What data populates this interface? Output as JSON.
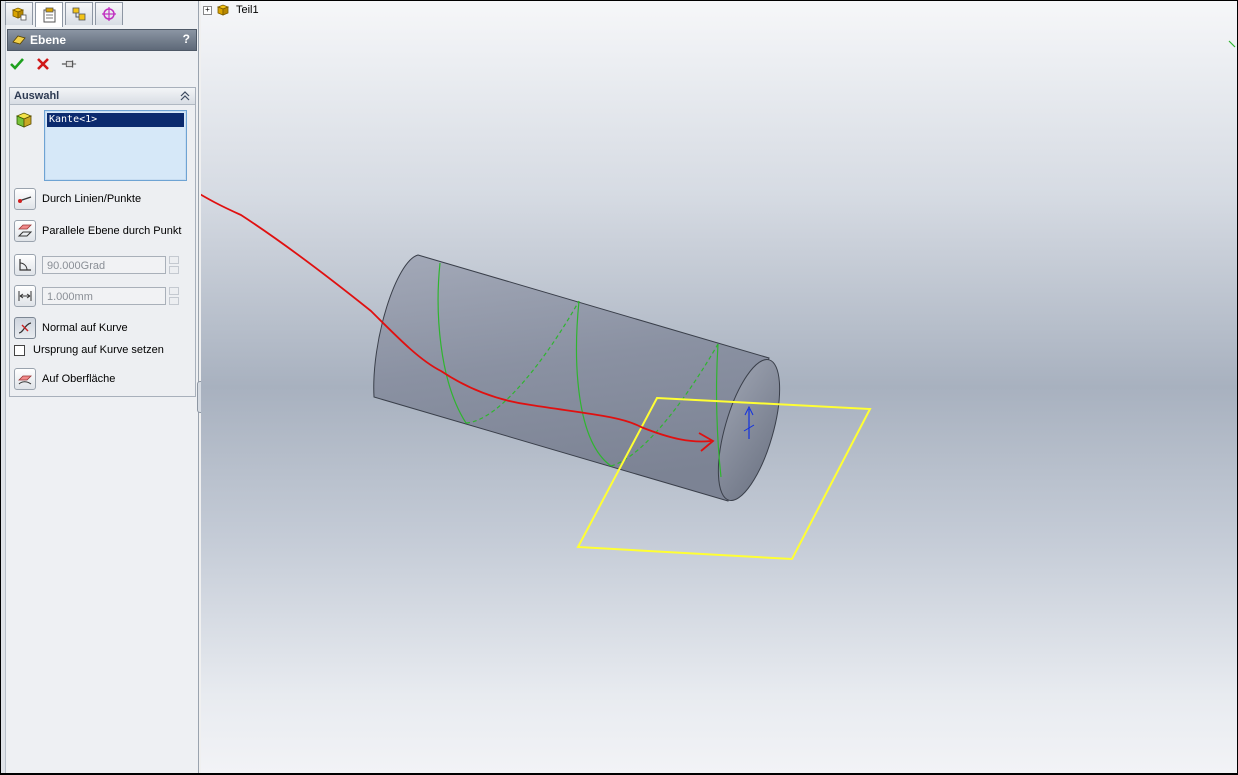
{
  "property_manager": {
    "tabs": [
      "feature-manager",
      "property-manager",
      "configuration-manager",
      "dimxpert-manager"
    ],
    "title": "Ebene",
    "help": "?",
    "actions": [
      "ok",
      "cancel",
      "pin"
    ],
    "selection_group": {
      "title": "Auswahl",
      "selected_items": [
        "Kante<1>"
      ]
    },
    "options": {
      "through_lines_points": "Durch Linien/Punkte",
      "parallel_plane": "Parallele Ebene durch Punkt",
      "angle_value": "90.000Grad",
      "distance_value": "1.000mm",
      "normal_to_curve": "Normal auf Kurve",
      "origin_on_curve": "Ursprung auf Kurve setzen",
      "on_surface": "Auf Oberfläche"
    }
  },
  "graphics": {
    "tree_root": "Teil1",
    "colors": {
      "sketch_curve": "#2fb52f",
      "preview_plane": "#ffff33",
      "annotation_arrow": "#e01010",
      "cylinder": "#8e95a6"
    }
  }
}
